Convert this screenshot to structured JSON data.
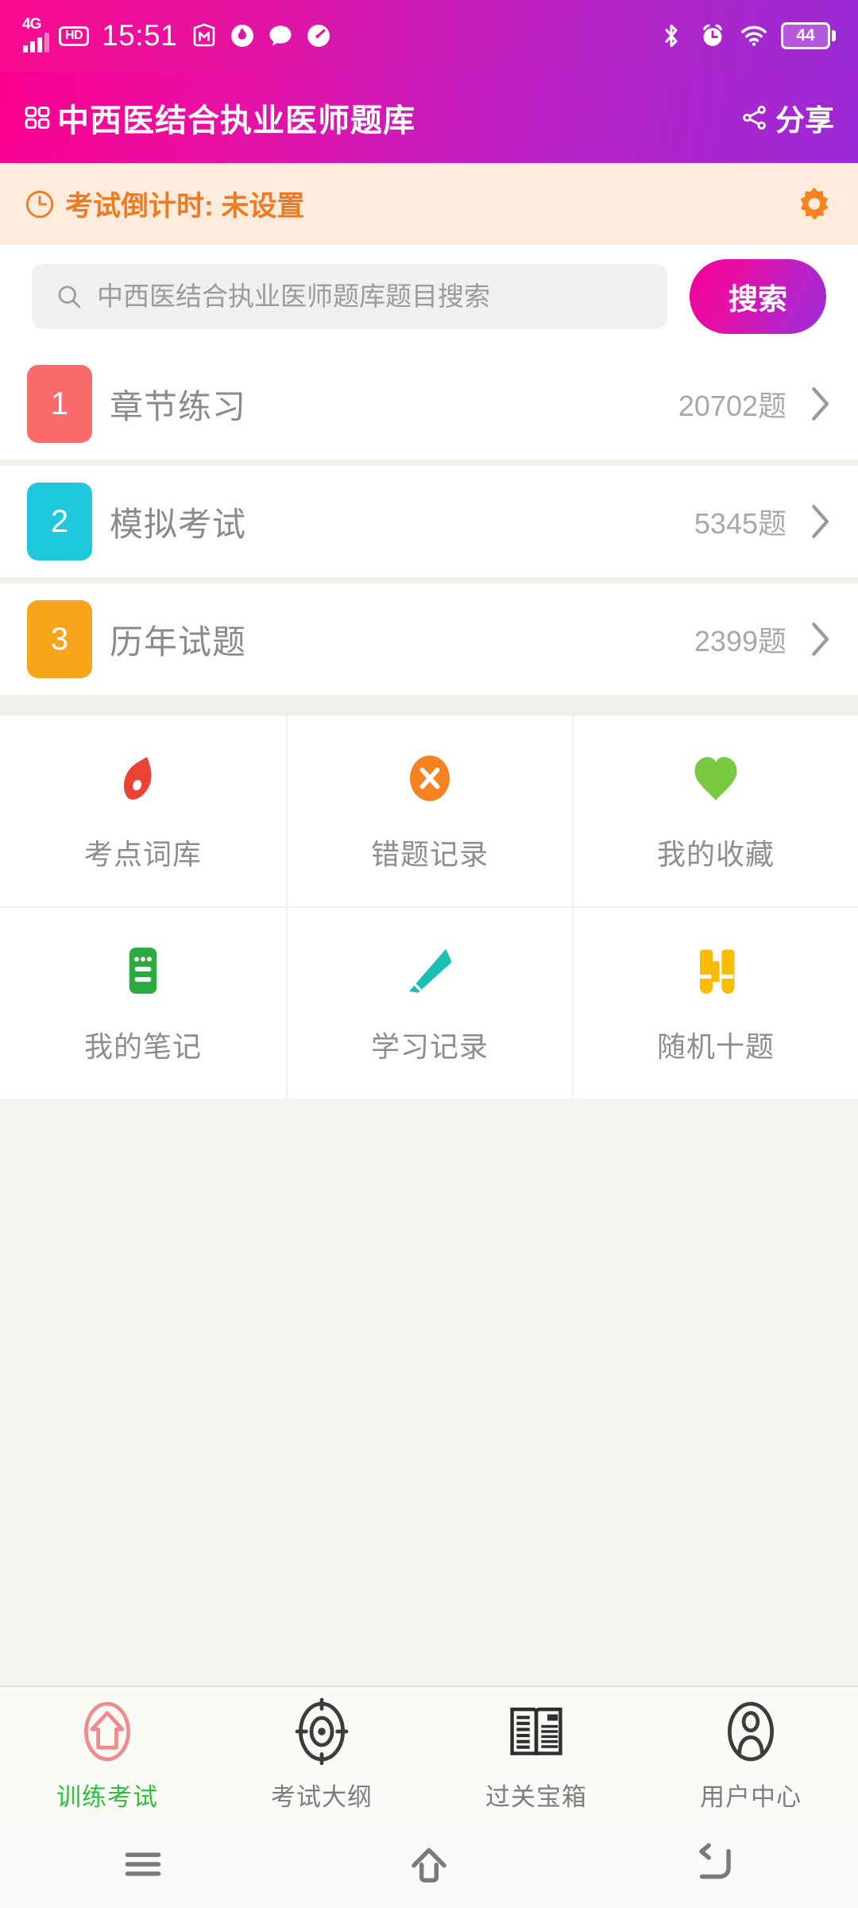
{
  "statusbar": {
    "network_label": "4G",
    "hd_label": "HD",
    "time": "15:51",
    "left_icons": [
      "signal-icon",
      "hd-icon",
      "app-m-icon",
      "flame-icon",
      "chat-bubble-icon",
      "speedometer-icon"
    ],
    "right_icons": [
      "bluetooth-icon",
      "alarm-clock-icon",
      "wifi-icon"
    ],
    "battery_percent": "44"
  },
  "header": {
    "grid_icon": "grid-icon",
    "title": "中西医结合执业医师题库",
    "share_icon": "share-icon",
    "share_label": "分享",
    "gradient_start": "#fb0090",
    "gradient_end": "#9b2ad6"
  },
  "countdown": {
    "clock_icon": "clock-icon",
    "text": "考试倒计时: 未设置",
    "settings_icon": "gear-icon",
    "accent": "#ee7b23",
    "background": "#fdecdc"
  },
  "search": {
    "icon": "search-icon",
    "placeholder": "中西医结合执业医师题库题目搜索",
    "value": "",
    "button_label": "搜索"
  },
  "list": [
    {
      "number": "1",
      "label": "章节练习",
      "count": "20702题",
      "color": "#fb6b6b",
      "chevron": "chevron-right-icon"
    },
    {
      "number": "2",
      "label": "模拟考试",
      "count": "5345题",
      "color": "#1fc8dd",
      "chevron": "chevron-right-icon"
    },
    {
      "number": "3",
      "label": "历年试题",
      "count": "2399题",
      "color": "#f7a51b",
      "chevron": "chevron-right-icon"
    }
  ],
  "grid": [
    {
      "label": "考点词库",
      "icon": "tag-icon",
      "color": "#ea4335"
    },
    {
      "label": "错题记录",
      "icon": "x-circle-icon",
      "color": "#f5831f"
    },
    {
      "label": "我的收藏",
      "icon": "heart-icon",
      "color": "#7ac943"
    },
    {
      "label": "我的笔记",
      "icon": "notebook-icon",
      "color": "#2bab3d"
    },
    {
      "label": "学习记录",
      "icon": "pencil-icon",
      "color": "#16bfb0"
    },
    {
      "label": "随机十题",
      "icon": "binoculars-icon",
      "color": "#fbbc05"
    }
  ],
  "tabs": [
    {
      "label": "训练考试",
      "icon": "home-exam-icon",
      "active": true,
      "color": "#2fc13c",
      "icon_color": "#f08b8b"
    },
    {
      "label": "考试大纲",
      "icon": "target-icon",
      "active": false,
      "color": "#7d7d7d",
      "icon_color": "#3c3c3c"
    },
    {
      "label": "过关宝箱",
      "icon": "news-book-icon",
      "active": false,
      "color": "#7d7d7d",
      "icon_color": "#3c3c3c"
    },
    {
      "label": "用户中心",
      "icon": "person-icon",
      "active": false,
      "color": "#7d7d7d",
      "icon_color": "#3c3c3c"
    }
  ],
  "android_nav": [
    {
      "icon": "menu-icon"
    },
    {
      "icon": "home-icon"
    },
    {
      "icon": "back-icon"
    }
  ]
}
